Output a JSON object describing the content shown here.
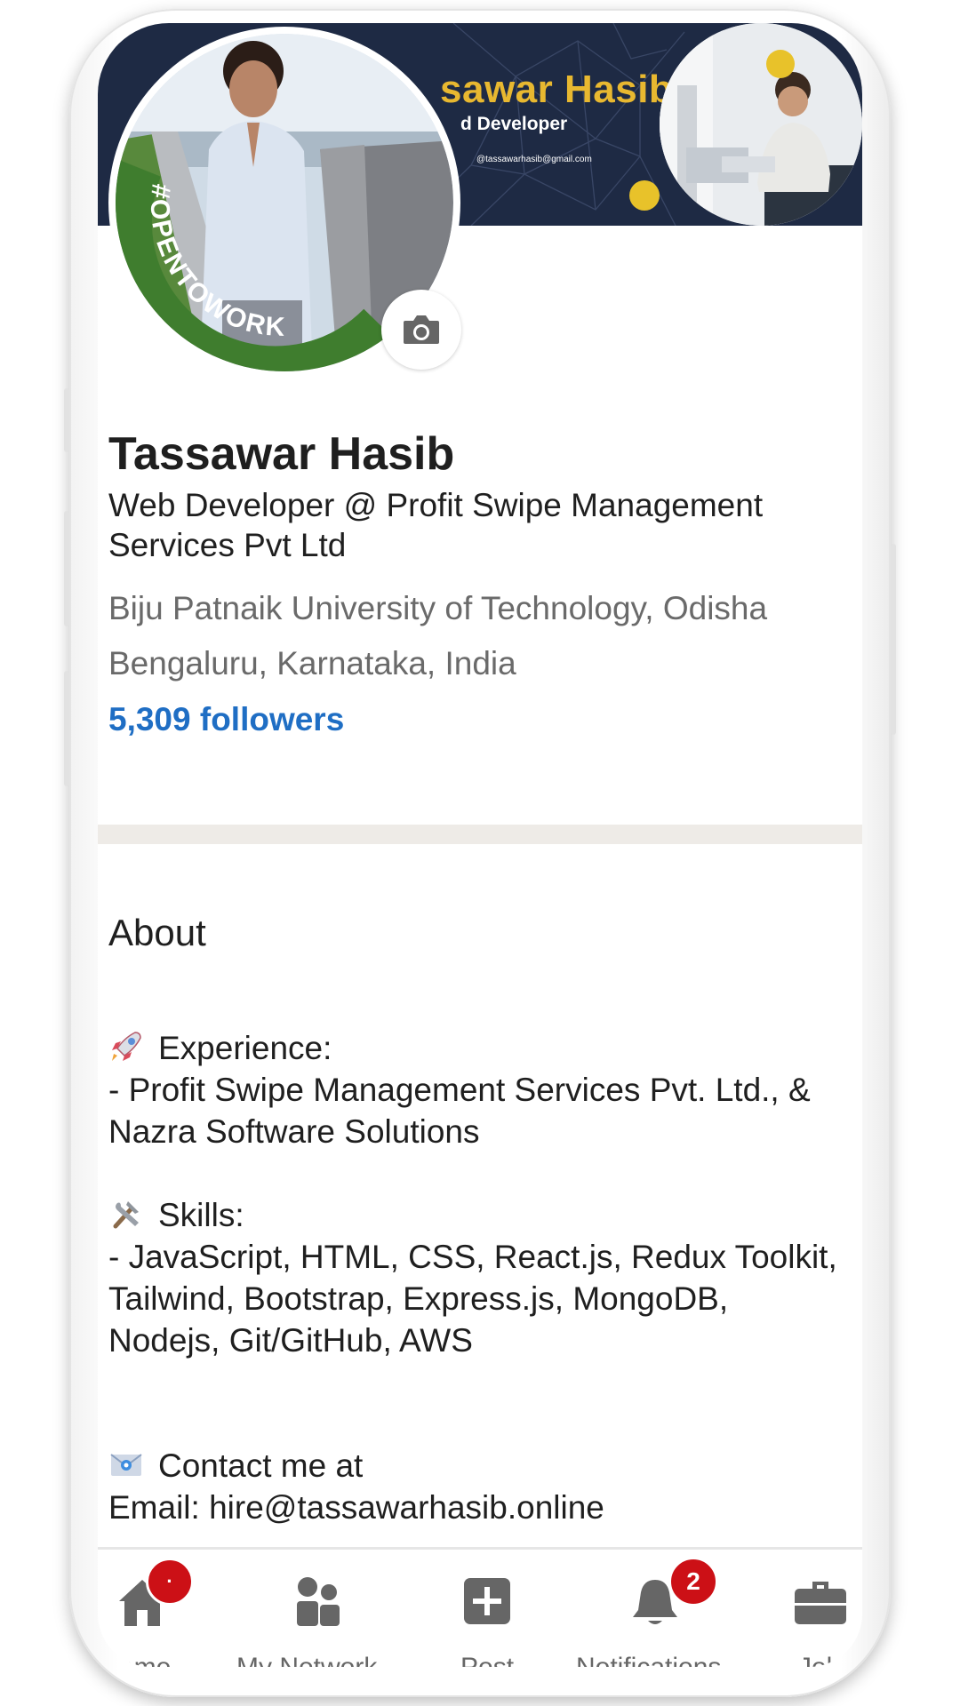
{
  "banner": {
    "name_text": "sawar Hasib",
    "role_text": "d Developer",
    "email_text": "@tassawarhasib@gmail.com"
  },
  "avatar": {
    "ring_text": "#OPENTOWORK",
    "ring_color": "#3f7d2e"
  },
  "profile": {
    "name": "Tassawar Hasib",
    "headline": "Web Developer @ Profit Swipe Management Services Pvt Ltd",
    "education": "Biju Patnaik University of Technology, Odisha",
    "location": "Bengaluru, Karnataka, India",
    "followers": "5,309 followers"
  },
  "about": {
    "title": "About",
    "experience_heading": "Experience:",
    "experience_text": "- Profit Swipe Management Services Pvt. Ltd., & Nazra Software Solutions",
    "skills_heading": "Skills:",
    "skills_text": "- JavaScript, HTML, CSS, React.js, Redux Toolkit, Tailwind, Bootstrap, Express.js, MongoDB, Nodejs, Git/GitHub, AWS",
    "contact_heading": "Contact me at",
    "contact_email": "Email: hire@tassawarhasib.online"
  },
  "nav": {
    "items": [
      {
        "label": "ome",
        "icon": "home-icon",
        "badge": "·"
      },
      {
        "label": "My Network",
        "icon": "network-icon"
      },
      {
        "label": "Post",
        "icon": "post-icon"
      },
      {
        "label": "Notifications",
        "icon": "bell-icon",
        "badge": "2"
      },
      {
        "label": "Job",
        "icon": "briefcase-icon"
      }
    ]
  },
  "colors": {
    "banner_bg": "#1e2a44",
    "banner_accent": "#e8b830",
    "link_blue": "#1f6ec4",
    "badge_red": "#cc1016",
    "nav_icon_gray": "#666666"
  }
}
